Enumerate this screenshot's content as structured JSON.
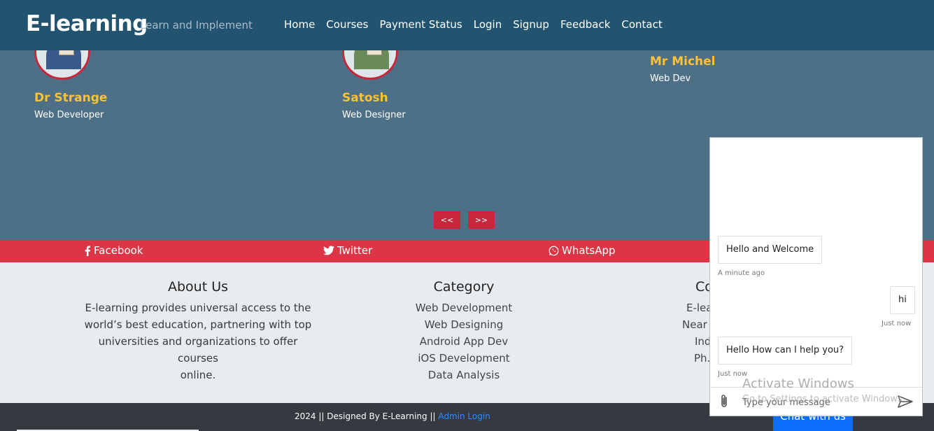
{
  "navbar": {
    "brand": "E-learning",
    "tagline": "Learn and Implement",
    "links": [
      "Home",
      "Courses",
      "Payment Status",
      "Login",
      "Signup",
      "Feedback",
      "Contact"
    ]
  },
  "testimonials": [
    {
      "name": "Dr Strange",
      "role": "Web Developer"
    },
    {
      "name": "Satosh",
      "role": "Web Designer"
    },
    {
      "name": "Mr Michel",
      "role": "Web Dev"
    }
  ],
  "carousel": {
    "prev_label": "<<",
    "next_label": ">>"
  },
  "social": {
    "facebook": "Facebook",
    "twitter": "Twitter",
    "whatsapp": "WhatsApp"
  },
  "about": {
    "title": "About Us",
    "lines": [
      "E-learning provides universal access to the",
      "world’s best education, partnering with top",
      "universities and organizations to offer courses",
      "online."
    ]
  },
  "category": {
    "title": "Category",
    "items": [
      "Web Development",
      "Web Designing",
      "Android App Dev",
      "iOS Development",
      "Data Analysis"
    ]
  },
  "contact": {
    "title": "Co",
    "lines": [
      "E-lea",
      "Near",
      "Ind",
      "Ph."
    ]
  },
  "footer": {
    "text": "2024 || Designed By E-Learning || ",
    "admin_link": "Admin Login",
    "chat_button": "Chat with us"
  },
  "chat": {
    "messages": [
      {
        "text": "Hello and Welcome",
        "time": "A minute ago",
        "from": "bot"
      },
      {
        "text": "hi",
        "time": "Just now",
        "from": "user"
      },
      {
        "text": "Hello How can I help you?",
        "time": "Just now",
        "from": "bot"
      }
    ],
    "input_placeholder": "Type your message"
  },
  "watermark": {
    "title": "Activate Windows",
    "subtitle": "Go to Settings to activate Windows."
  },
  "colors": {
    "navbar": "#225470",
    "section_bg": "#4e7087",
    "accent_red": "#dc3545",
    "name_yellow": "#ffc233",
    "footer": "#343a40",
    "link_blue": "#2f8cff"
  }
}
